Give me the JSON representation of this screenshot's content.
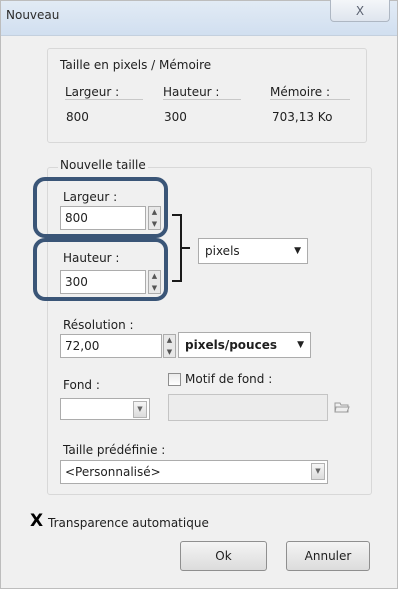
{
  "window": {
    "title": "Nouveau",
    "close_icon": "close-icon",
    "close_glyph": "X"
  },
  "memory": {
    "group_label": "Taille en pixels / Mémoire",
    "width_label": "Largeur :",
    "height_label": "Hauteur :",
    "memory_label": "Mémoire :",
    "width_value": "800",
    "height_value": "300",
    "memory_value": "703,13 Ko"
  },
  "new_size": {
    "group_label": "Nouvelle taille",
    "width_label": "Largeur :",
    "width_value": "800",
    "height_label": "Hauteur :",
    "height_value": "300",
    "unit_selected": "pixels"
  },
  "resolution": {
    "label": "Résolution :",
    "value": "72,00",
    "unit_selected": "pixels/pouces"
  },
  "background": {
    "fond_label": "Fond :",
    "fond_value": "",
    "pattern_label": "Motif de fond :",
    "pattern_value": "",
    "browse_icon": "folder-browse-icon"
  },
  "preset": {
    "label": "Taille prédéfinie :",
    "value": "<Personnalisé>"
  },
  "auto_transparency": {
    "mark": "X",
    "label": "Transparence automatique"
  },
  "buttons": {
    "ok": "Ok",
    "cancel": "Annuler"
  },
  "colors": {
    "highlight": "#3a5577",
    "title_bar": "#d9e4f2",
    "dialog_bg": "#f0f0f0"
  }
}
